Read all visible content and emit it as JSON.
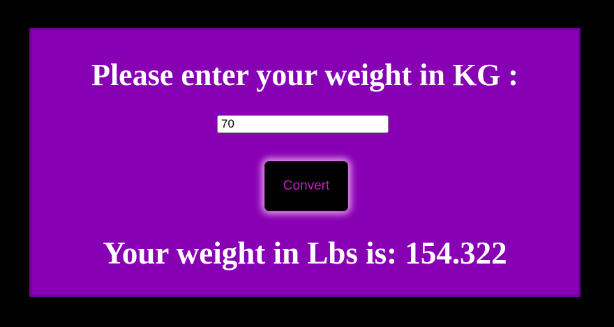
{
  "form": {
    "title": "Please enter your weight in KG :",
    "input_value": "70",
    "button_label": "Convert",
    "result_text": "Your weight in Lbs is: 154.322"
  },
  "colors": {
    "page_background": "#000000",
    "card_background": "#8800b3",
    "text": "#ffffff",
    "button_background": "#000000",
    "button_text": "#c81ec8"
  }
}
